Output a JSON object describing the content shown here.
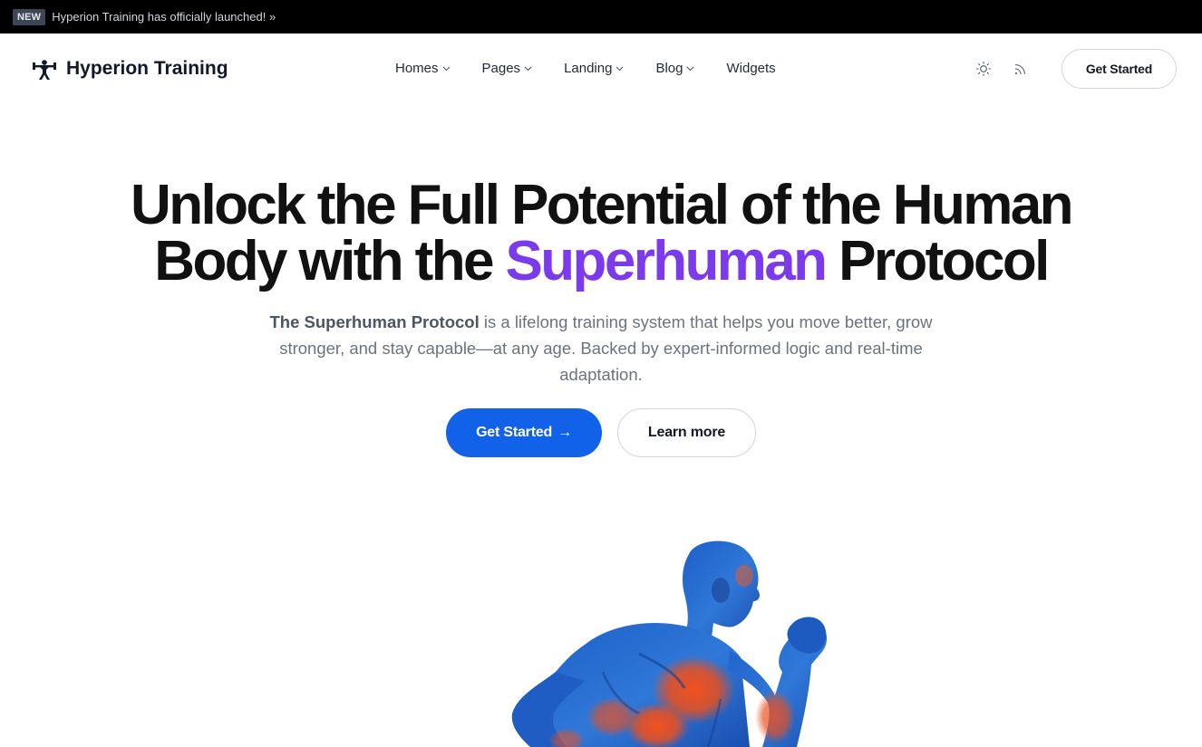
{
  "announcement": {
    "badge": "NEW",
    "text": "Hyperion Training has officially launched! »"
  },
  "brand": {
    "name": "Hyperion Training",
    "icon": "weightlifter-icon"
  },
  "nav": {
    "items": [
      {
        "label": "Homes",
        "has_dropdown": true
      },
      {
        "label": "Pages",
        "has_dropdown": true
      },
      {
        "label": "Landing",
        "has_dropdown": true
      },
      {
        "label": "Blog",
        "has_dropdown": true
      },
      {
        "label": "Widgets",
        "has_dropdown": false
      }
    ],
    "icons": [
      "sun-icon",
      "rss-icon"
    ],
    "cta_label": "Get Started"
  },
  "hero": {
    "title_line1": "Unlock the Full Potential of the Human",
    "title_line2_prefix": "Body with the ",
    "title_accent": "Superhuman",
    "title_line2_suffix": " Protocol",
    "subtitle_strong": "The Superhuman Protocol",
    "subtitle_rest": " is a lifelong training system that helps you move better, grow stronger, and stay capable—at any age. Backed by expert-informed logic and real-time adaptation.",
    "primary_button": "Get Started",
    "primary_button_arrow": "→",
    "secondary_button": "Learn more",
    "image": "running-athlete-illustration"
  },
  "colors": {
    "accent_purple": "#7c3aed",
    "primary_blue": "#1162e8",
    "announcement_bg": "#000000"
  }
}
